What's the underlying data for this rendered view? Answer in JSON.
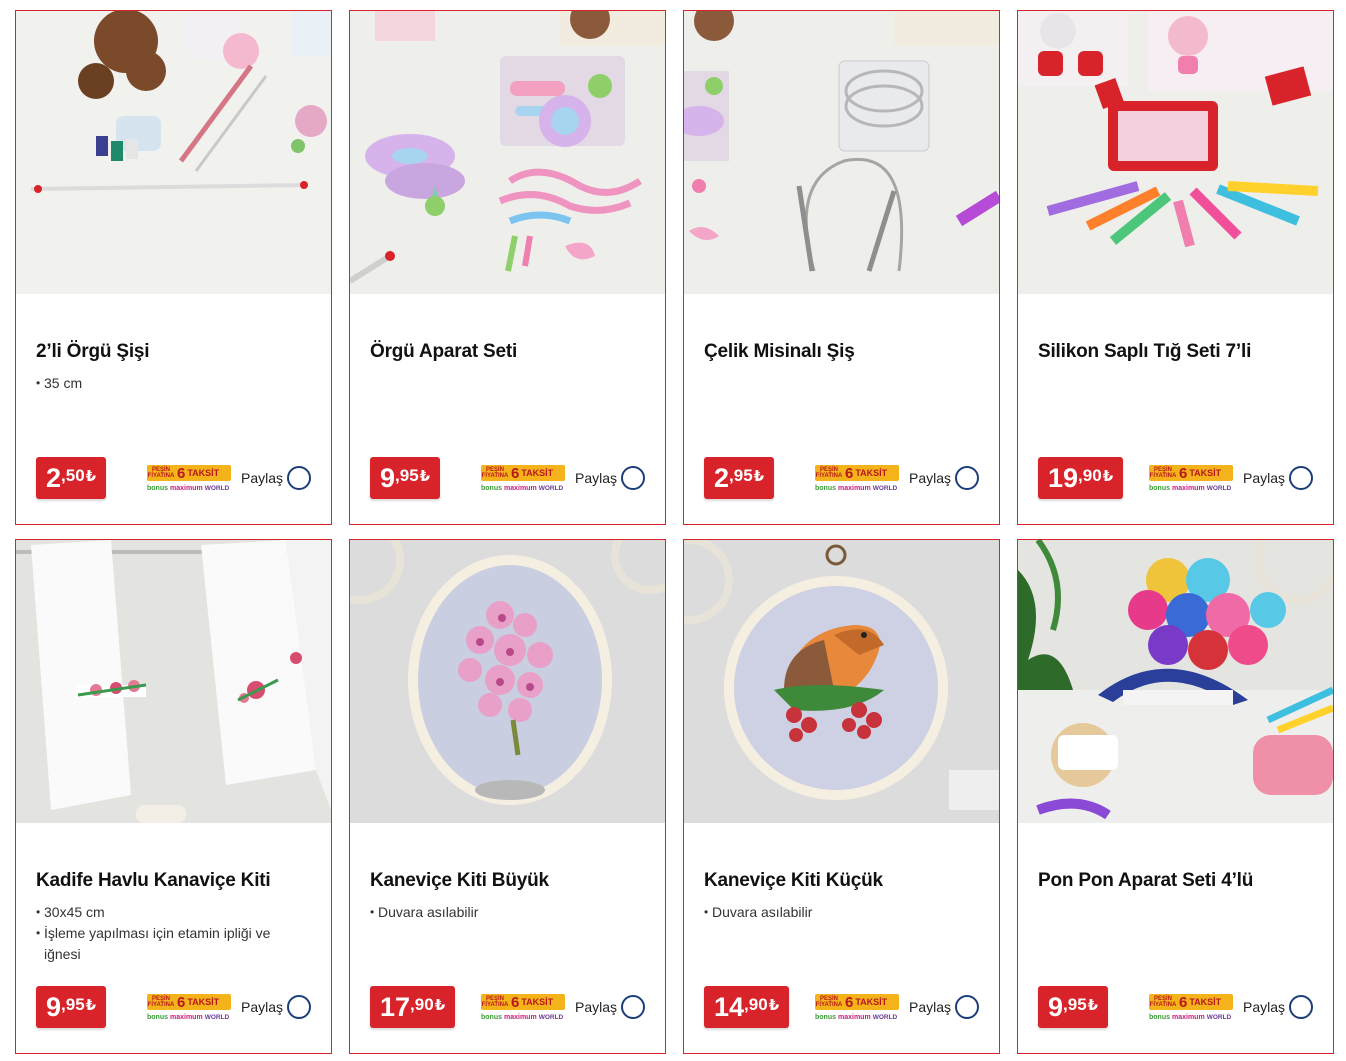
{
  "products": [
    {
      "title": "2’li Örgü Şişi",
      "features": [
        "35 cm"
      ],
      "price_main": "2",
      "price_dec": ",50",
      "currency": "₺"
    },
    {
      "title": "Örgü Aparat Seti",
      "features": [],
      "price_main": "9",
      "price_dec": ",95",
      "currency": "₺"
    },
    {
      "title": "Çelik Misinalı Şiş",
      "features": [],
      "price_main": "2",
      "price_dec": ",95",
      "currency": "₺"
    },
    {
      "title": "Silikon Saplı Tığ Seti 7’li",
      "features": [],
      "price_main": "19",
      "price_dec": ",90",
      "currency": "₺"
    },
    {
      "title": "Kadife Havlu Kanaviçe Kiti",
      "features": [
        "30x45 cm",
        "İşleme yapılması için etamin ipliği ve iğnesi"
      ],
      "price_main": "9",
      "price_dec": ",95",
      "currency": "₺"
    },
    {
      "title": "Kaneviçe Kiti Büyük",
      "features": [
        "Duvara asılabilir"
      ],
      "price_main": "17",
      "price_dec": ",90",
      "currency": "₺"
    },
    {
      "title": "Kaneviçe Kiti Küçük",
      "features": [
        "Duvara asılabilir"
      ],
      "price_main": "14",
      "price_dec": ",90",
      "currency": "₺"
    },
    {
      "title": "Pon Pon Aparat Seti 4’lü",
      "features": [],
      "price_main": "9",
      "price_dec": ",95",
      "currency": "₺"
    }
  ],
  "taksit": {
    "pesin": "PEŞİN FİYATINA",
    "count": "6",
    "label": "TAKSİT",
    "bonus": "bonus",
    "maximum": "maximum",
    "world": "WORLD"
  },
  "share_label": "Paylaş",
  "colors": {
    "accent": "#d8232a",
    "share_ring": "#1c3f7a",
    "taksit_bg": "#f5b31b"
  }
}
